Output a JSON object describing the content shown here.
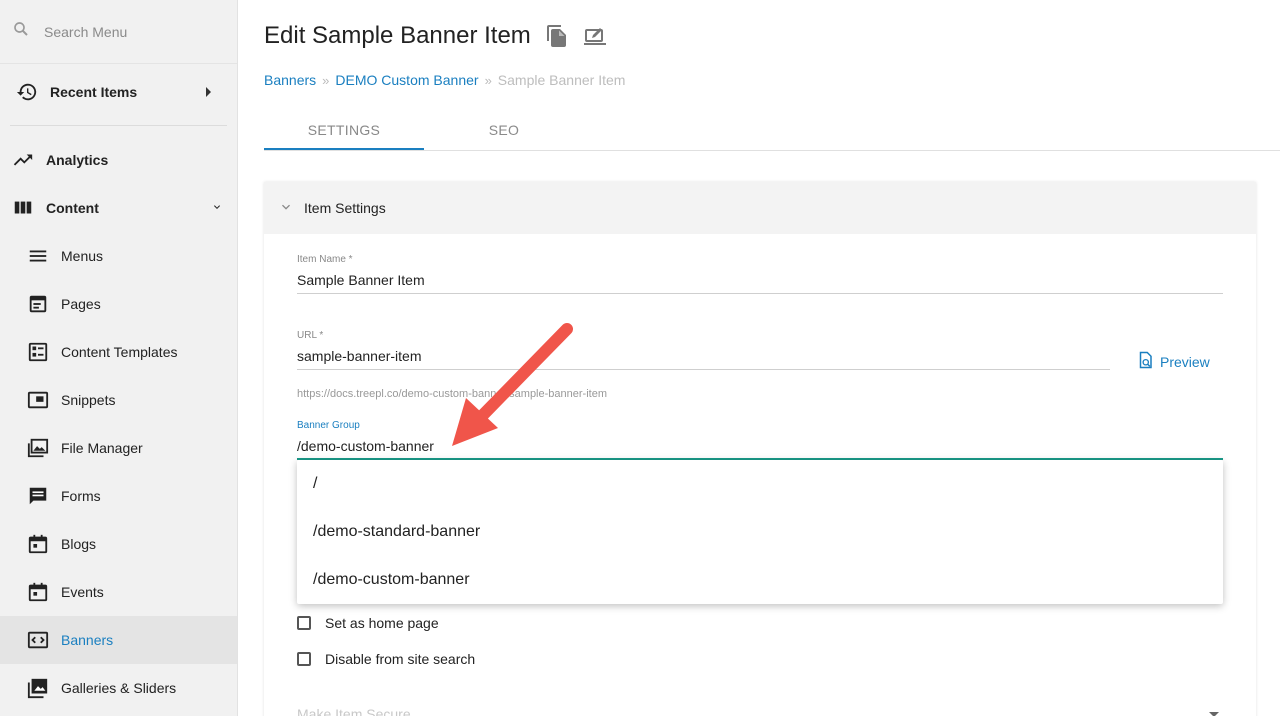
{
  "sidebar": {
    "search_placeholder": "Search Menu",
    "recent_label": "Recent Items",
    "analytics_label": "Analytics",
    "content_label": "Content",
    "items": [
      {
        "label": "Menus",
        "icon": "menu-lines-icon"
      },
      {
        "label": "Pages",
        "icon": "page-icon"
      },
      {
        "label": "Content Templates",
        "icon": "template-icon"
      },
      {
        "label": "Snippets",
        "icon": "snippet-icon"
      },
      {
        "label": "File Manager",
        "icon": "image-folder-icon"
      },
      {
        "label": "Forms",
        "icon": "chat-form-icon"
      },
      {
        "label": "Blogs",
        "icon": "calendar-icon"
      },
      {
        "label": "Events",
        "icon": "calendar-icon"
      },
      {
        "label": "Banners",
        "icon": "code-frame-icon",
        "active": true
      },
      {
        "label": "Galleries & Sliders",
        "icon": "gallery-icon"
      }
    ]
  },
  "header": {
    "title": "Edit Sample Banner Item",
    "breadcrumbs": [
      "Banners",
      "DEMO Custom Banner",
      "Sample Banner Item"
    ]
  },
  "tabs": [
    "SETTINGS",
    "SEO"
  ],
  "card": {
    "title": "Item Settings",
    "item_name_label": "Item Name *",
    "item_name_value": "Sample Banner Item",
    "url_label": "URL *",
    "url_value": "sample-banner-item",
    "preview_label": "Preview",
    "url_hint": "https://docs.treepl.co/demo-custom-banner/sample-banner-item",
    "banner_group_label": "Banner Group",
    "banner_group_value": "/demo-custom-banner",
    "options": [
      "/",
      "/demo-standard-banner",
      "/demo-custom-banner"
    ],
    "home_page_label": "Set as home page",
    "disable_search_label": "Disable from site search",
    "secure_label": "Make Item Secure"
  },
  "colors": {
    "accent": "#1a7fc0",
    "focus_underline": "#1a9b8a",
    "annotation_arrow": "#f0554a"
  }
}
